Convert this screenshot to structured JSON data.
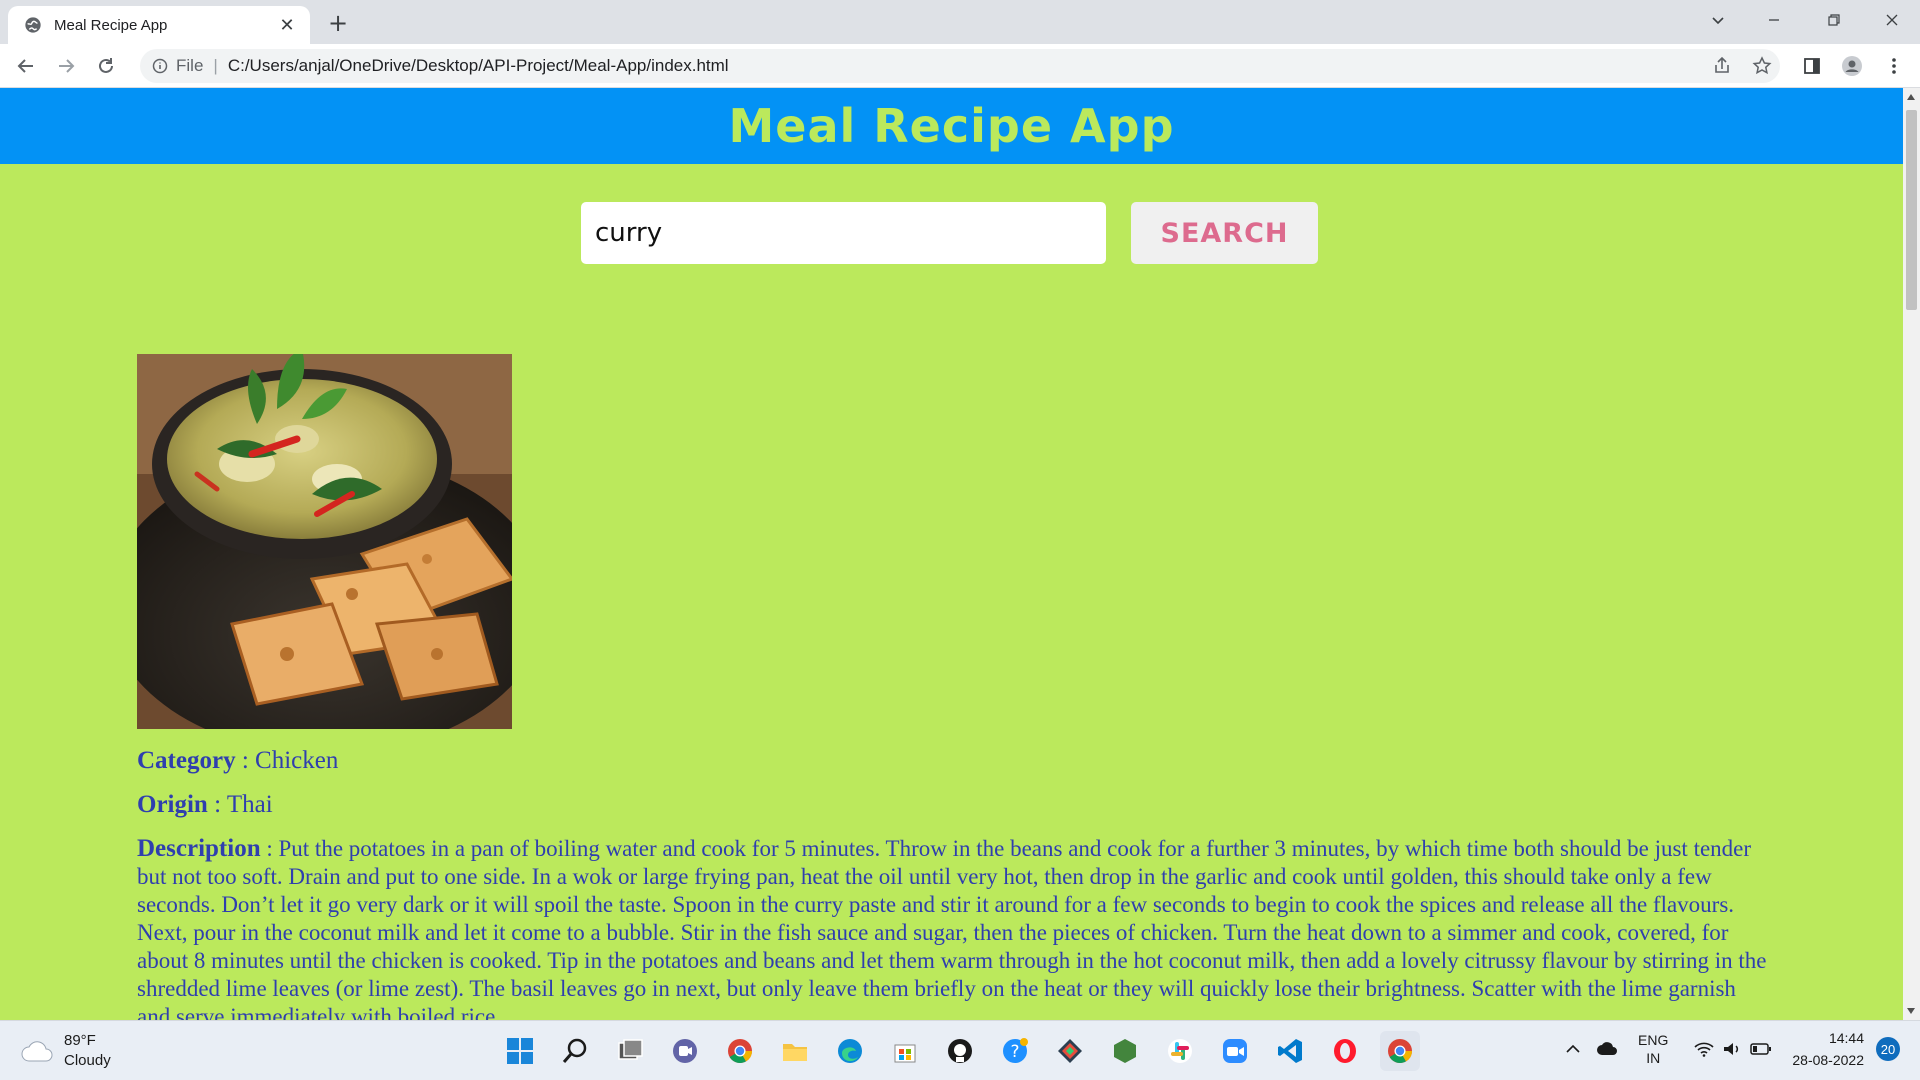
{
  "browser": {
    "tab_title": "Meal Recipe App",
    "url_scheme_label": "File",
    "url": "C:/Users/anjal/OneDrive/Desktop/API-Project/Meal-App/index.html"
  },
  "app": {
    "title": "Meal Recipe App",
    "search": {
      "value": "curry",
      "button_label": "SEARCH"
    },
    "meal": {
      "category_label": "Category",
      "category": "Chicken",
      "origin_label": "Origin",
      "origin": "Thai",
      "description_label": "Description",
      "description": "Put the potatoes in a pan of boiling water and cook for 5 minutes. Throw in the beans and cook for a further 3 minutes, by which time both should be just tender but not too soft. Drain and put to one side. In a wok or large frying pan, heat the oil until very hot, then drop in the garlic and cook until golden, this should take only a few seconds. Don’t let it go very dark or it will spoil the taste. Spoon in the curry paste and stir it around for a few seconds to begin to cook the spices and release all the flavours. Next, pour in the coconut milk and let it come to a bubble. Stir in the fish sauce and sugar, then the pieces of chicken. Turn the heat down to a simmer and cook, covered, for about 8 minutes until the chicken is cooked. Tip in the potatoes and beans and let them warm through in the hot coconut milk, then add a lovely citrussy flavour by stirring in the shredded lime leaves (or lime zest). The basil leaves go in next, but only leave them briefly on the heat or they will quickly lose their brightness. Scatter with the lime garnish and serve immediately with boiled rice."
    }
  },
  "taskbar": {
    "weather_temp": "89°F",
    "weather_desc": "Cloudy",
    "lang_top": "ENG",
    "lang_bottom": "IN",
    "time": "14:44",
    "date": "28-08-2022",
    "notification_count": "20"
  },
  "colors": {
    "page_bg": "#bbe95c",
    "header_bg": "#0392f5",
    "title_color": "#bbe95c",
    "button_text": "#dd6b8e",
    "text_blue": "#2f3fae"
  }
}
